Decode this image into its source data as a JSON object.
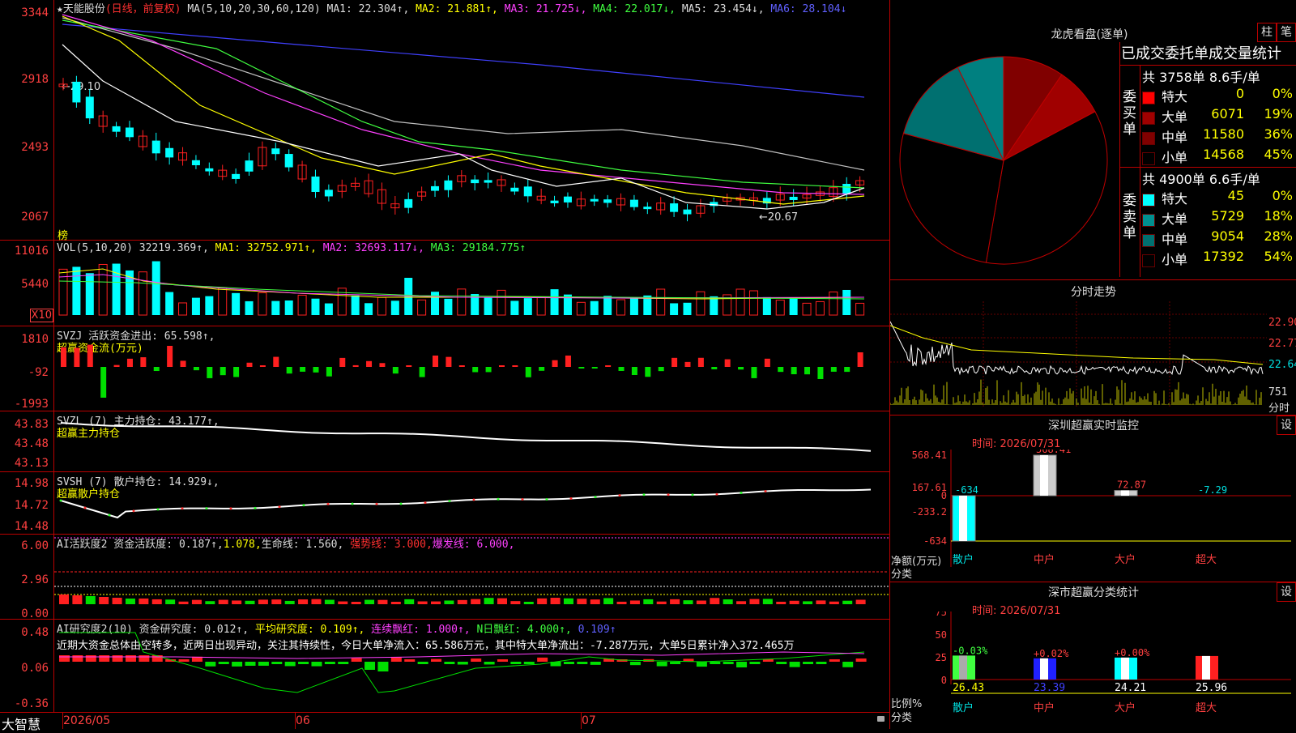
{
  "app": {
    "logo": "大智慧",
    "lock_icon": "lock-icon"
  },
  "main_chart": {
    "y_ticks": [
      "3344",
      "2918",
      "2493",
      "2067"
    ],
    "header": {
      "star": "★",
      "name": "天能股份",
      "mode": "(日线，前复权)",
      "ma_label": "MA(5,10,20,30,60,120)",
      "ma1": "MA1: 22.304↑,",
      "ma2": "MA2: 21.881↑,",
      "ma3": "MA3: 21.725↓,",
      "ma4": "MA4: 22.017↓,",
      "ma5": "MA5: 23.454↓,",
      "ma6": "MA6: 28.104↓"
    },
    "high_label": "←29.10",
    "low_label": "←20.67",
    "bang_label": "榜",
    "colors": {
      "up": "#ff2020",
      "down": "#00ffff",
      "ma1": "#ffffff",
      "ma2": "#ffff00",
      "ma3": "#ff40ff",
      "ma4": "#40ff40",
      "ma5": "#c0c0c0",
      "ma6": "#4040ff"
    }
  },
  "vol_chart": {
    "y_ticks": [
      "11016",
      "5440"
    ],
    "unit": "X10",
    "header": {
      "label": "VOL(5,10,20)",
      "value": "32219.369↑,",
      "ma1": "MA1: 32752.971↑,",
      "ma2": "MA2: 32693.117↓,",
      "ma3": "MA3: 29184.775↑"
    }
  },
  "svzj": {
    "y_ticks": [
      "1810",
      "-92",
      "-1993"
    ],
    "header": "SVZJ  活跃资金进出: 65.598↑,",
    "sub": "超赢资金流(万元)"
  },
  "svzl": {
    "y_ticks": [
      "43.83",
      "43.48",
      "43.13"
    ],
    "header": "SVZL (7) 主力持仓: 43.177↑,",
    "sub": "超赢主力持仓"
  },
  "svsh": {
    "y_ticks": [
      "14.98",
      "14.72",
      "14.48"
    ],
    "header": "SVSH (7) 散户持仓: 14.929↓,",
    "sub": "超赢散户持仓"
  },
  "ai_active": {
    "y_ticks": [
      "6.00",
      "2.96",
      "0.00"
    ],
    "h1": "AI活跃度2 资金活跃度: 0.187↑,",
    "h2": "1.078,",
    "h3": "生命线: 1.560,",
    "h4": "强势线: 3.000,",
    "h5": "爆发线: 6.000,"
  },
  "ai_research": {
    "y_ticks": [
      "0.48",
      "0.06",
      "-0.36"
    ],
    "h1": "AI研究度2(10) 资金研究度: 0.012↑,",
    "h2": "平均研究度: 0.109↑,",
    "h3": "连续飘红: 1.000↑,",
    "h4": "N日飘红: 4.000↑,",
    "h5": "0.109↑",
    "comment": "近期大资金总体由空转多，近两日出现异动，关注其持续性，今日大单净流入：65.586万元，其中特大单净流出：-7.287万元，大单5日累计净入372.465万"
  },
  "x_axis": {
    "labels": [
      "2026/05",
      "06",
      "07"
    ]
  },
  "lhb": {
    "title": "龙虎看盘(逐单)",
    "btn_zhu": "柱",
    "btn_bi": "笔",
    "stats_title": "已成交委托单成交量统计",
    "buy": {
      "label": "委买单",
      "summary": "共 3758单 8.6手/单",
      "rows": [
        {
          "name": "特大",
          "vol": "0",
          "pct": "0%",
          "color": "#ff0000"
        },
        {
          "name": "大单",
          "vol": "6071",
          "pct": "19%",
          "color": "#a00000"
        },
        {
          "name": "中单",
          "vol": "11580",
          "pct": "36%",
          "color": "#800000"
        },
        {
          "name": "小单",
          "vol": "14568",
          "pct": "45%",
          "color": "#000000"
        }
      ]
    },
    "sell": {
      "label": "委卖单",
      "summary": "共 4900单 6.6手/单",
      "rows": [
        {
          "name": "特大",
          "vol": "45",
          "pct": "0%",
          "color": "#00ffff"
        },
        {
          "name": "大单",
          "vol": "5729",
          "pct": "18%",
          "color": "#009090"
        },
        {
          "name": "中单",
          "vol": "9054",
          "pct": "28%",
          "color": "#007070"
        },
        {
          "name": "小单",
          "vol": "17392",
          "pct": "54%",
          "color": "#000000"
        }
      ]
    }
  },
  "fenshi": {
    "title": "分时走势",
    "y_ticks": [
      "22.90",
      "22.77",
      "22.64"
    ],
    "vol_tick": "751",
    "label": "分时"
  },
  "sz_monitor": {
    "title": "深圳超赢实时监控",
    "set": "设",
    "time": "时间: 2026/07/31",
    "y_ticks": [
      "568.41",
      "167.61",
      "0",
      "-233.2",
      "-634"
    ],
    "ylabel": "净额(万元)",
    "xlabel": "分类",
    "categories": [
      "散户",
      "中户",
      "大户",
      "超大"
    ],
    "values_text": [
      "-634",
      "568.41",
      "72.87",
      "-7.29"
    ]
  },
  "sz_class": {
    "title": "深市超赢分类统计",
    "set": "设",
    "time": "时间: 2026/07/31",
    "y_ticks": [
      "75",
      "50",
      "25",
      "0"
    ],
    "ylabel": "比例%",
    "xlabel": "分类",
    "categories": [
      "散户",
      "中户",
      "大户",
      "超大"
    ],
    "change_text": [
      "-0.03%",
      "+0.02%",
      "+0.00%",
      ""
    ],
    "values_text": [
      "26.43",
      "23.39",
      "24.21",
      "25.96"
    ]
  },
  "chart_data": [
    {
      "type": "pie",
      "title": "龙虎看盘(逐单)",
      "categories": [
        "委买中单",
        "委买大单",
        "委买小单",
        "委卖小单",
        "委卖中单",
        "委卖大单"
      ],
      "values": [
        9.5,
        7.7,
        35.5,
        26.5,
        13.5,
        7.3
      ]
    },
    {
      "type": "bar",
      "title": "深圳超赢实时监控",
      "categories": [
        "散户",
        "中户",
        "大户",
        "超大"
      ],
      "values": [
        -634,
        568.41,
        72.87,
        -7.29
      ],
      "ylim": [
        -634,
        568.41
      ]
    },
    {
      "type": "bar",
      "title": "深市超赢分类统计",
      "categories": [
        "散户",
        "中户",
        "大户",
        "超大"
      ],
      "values": [
        26.43,
        23.39,
        24.21,
        25.96
      ],
      "ylim": [
        0,
        75
      ]
    }
  ]
}
